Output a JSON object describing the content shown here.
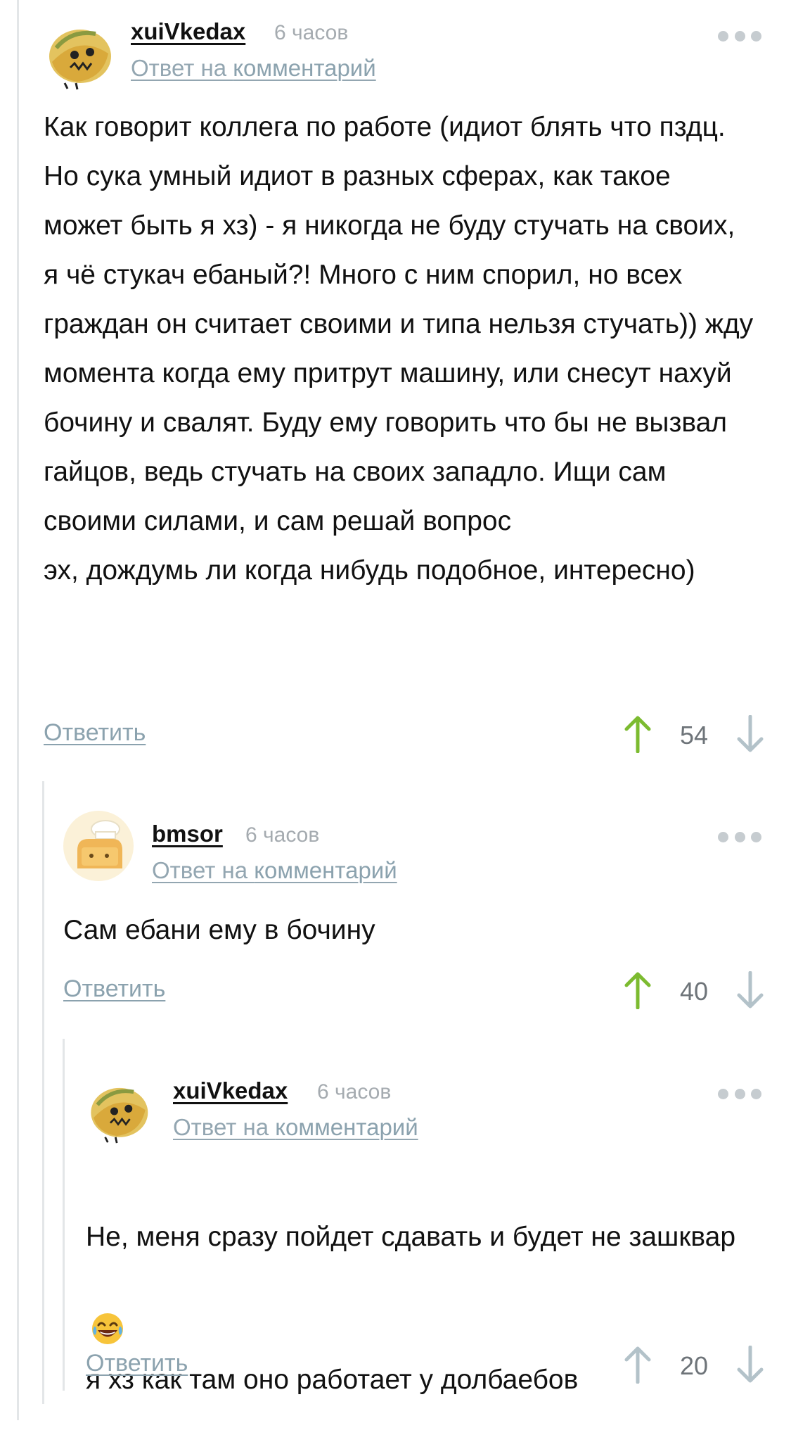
{
  "colors": {
    "upvote_active": "#7cbb30",
    "upvote_inactive": "#b3c2c9",
    "downvote": "#b3c2c9",
    "link": "#8ba2ae",
    "timestamp": "#a5abb0",
    "thread_line": "#e3e6e8"
  },
  "comments": [
    {
      "username": "xuiVkedax",
      "time": "6 часов",
      "reply_prefix": "Ответ на ",
      "reply_link": "комментарий",
      "avatar_icon": "taco-avatar-icon",
      "text": "Как говорит коллега по работе (идиот блять что пздц. Но сука умный идиот в разных сферах, как такое может быть я хз) - я никогда не буду стучать на своих, я чё стукач ебаный?! Много с ним спорил, но всех граждан он считает своими и типа нельзя стучать)) жду момента когда ему притрут машину, или снесут нахуй бочину и свалят. Буду ему говорить что бы не вызвал гайцов, ведь стучать на своих западло. Ищи сам своими силами, и сам решай вопрос\nэх, дождумь ли когда нибудь подобное, интересно)",
      "reply_label": "Ответить",
      "score": "54",
      "upvoted": true
    },
    {
      "username": "bmsor",
      "time": "6 часов",
      "reply_prefix": "Ответ на ",
      "reply_link": "комментарий",
      "avatar_icon": "toast-chef-avatar-icon",
      "text": "Сам ебани ему в бочину",
      "reply_label": "Ответить",
      "score": "40",
      "upvoted": true
    },
    {
      "username": "xuiVkedax",
      "time": "6 часов",
      "reply_prefix": "Ответ на ",
      "reply_link": "комментарий",
      "avatar_icon": "taco-avatar-icon",
      "text_line1": "Не, меня сразу пойдет сдавать и будет не зашквар",
      "emoji": "tears-of-joy-emoji",
      "text_line2": "я хз как там оно работает у долбаебов",
      "reply_label": "Ответить",
      "score": "20",
      "upvoted": false
    }
  ]
}
